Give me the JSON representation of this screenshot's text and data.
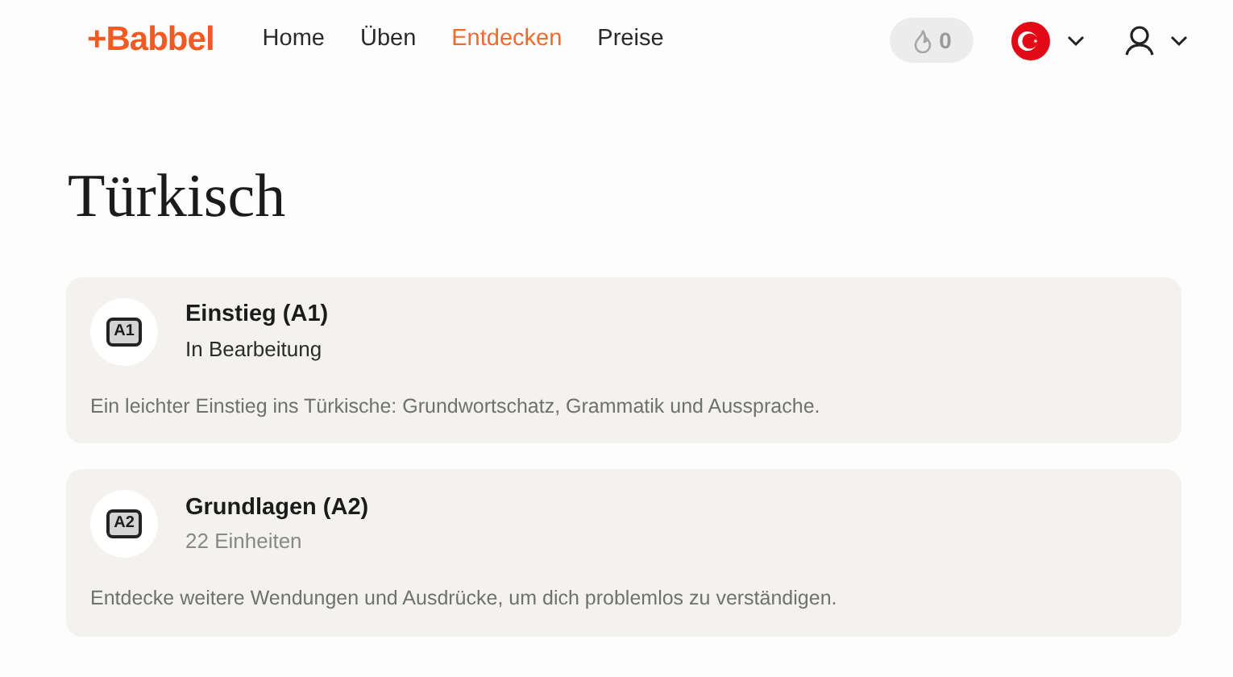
{
  "header": {
    "logo": "+Babbel",
    "nav": [
      {
        "label": "Home",
        "selected": false
      },
      {
        "label": "Üben",
        "selected": false
      },
      {
        "label": "Entdecken",
        "selected": true
      },
      {
        "label": "Preise",
        "selected": false
      }
    ],
    "streak": "0"
  },
  "title": "Türkisch",
  "courses": [
    {
      "badge": "A1",
      "title": "Einstieg (A1)",
      "status": "In Bearbeitung",
      "in_progress": true,
      "description": "Ein leichter Einstieg ins Türkische: Grundwortschatz, Grammatik und Aussprache."
    },
    {
      "badge": "A2",
      "title": "Grundlagen (A2)",
      "status": "22 Einheiten",
      "in_progress": false,
      "description": "Entdecke weitere Wendungen und Ausdrücke, um dich problemlos zu verständigen."
    }
  ]
}
